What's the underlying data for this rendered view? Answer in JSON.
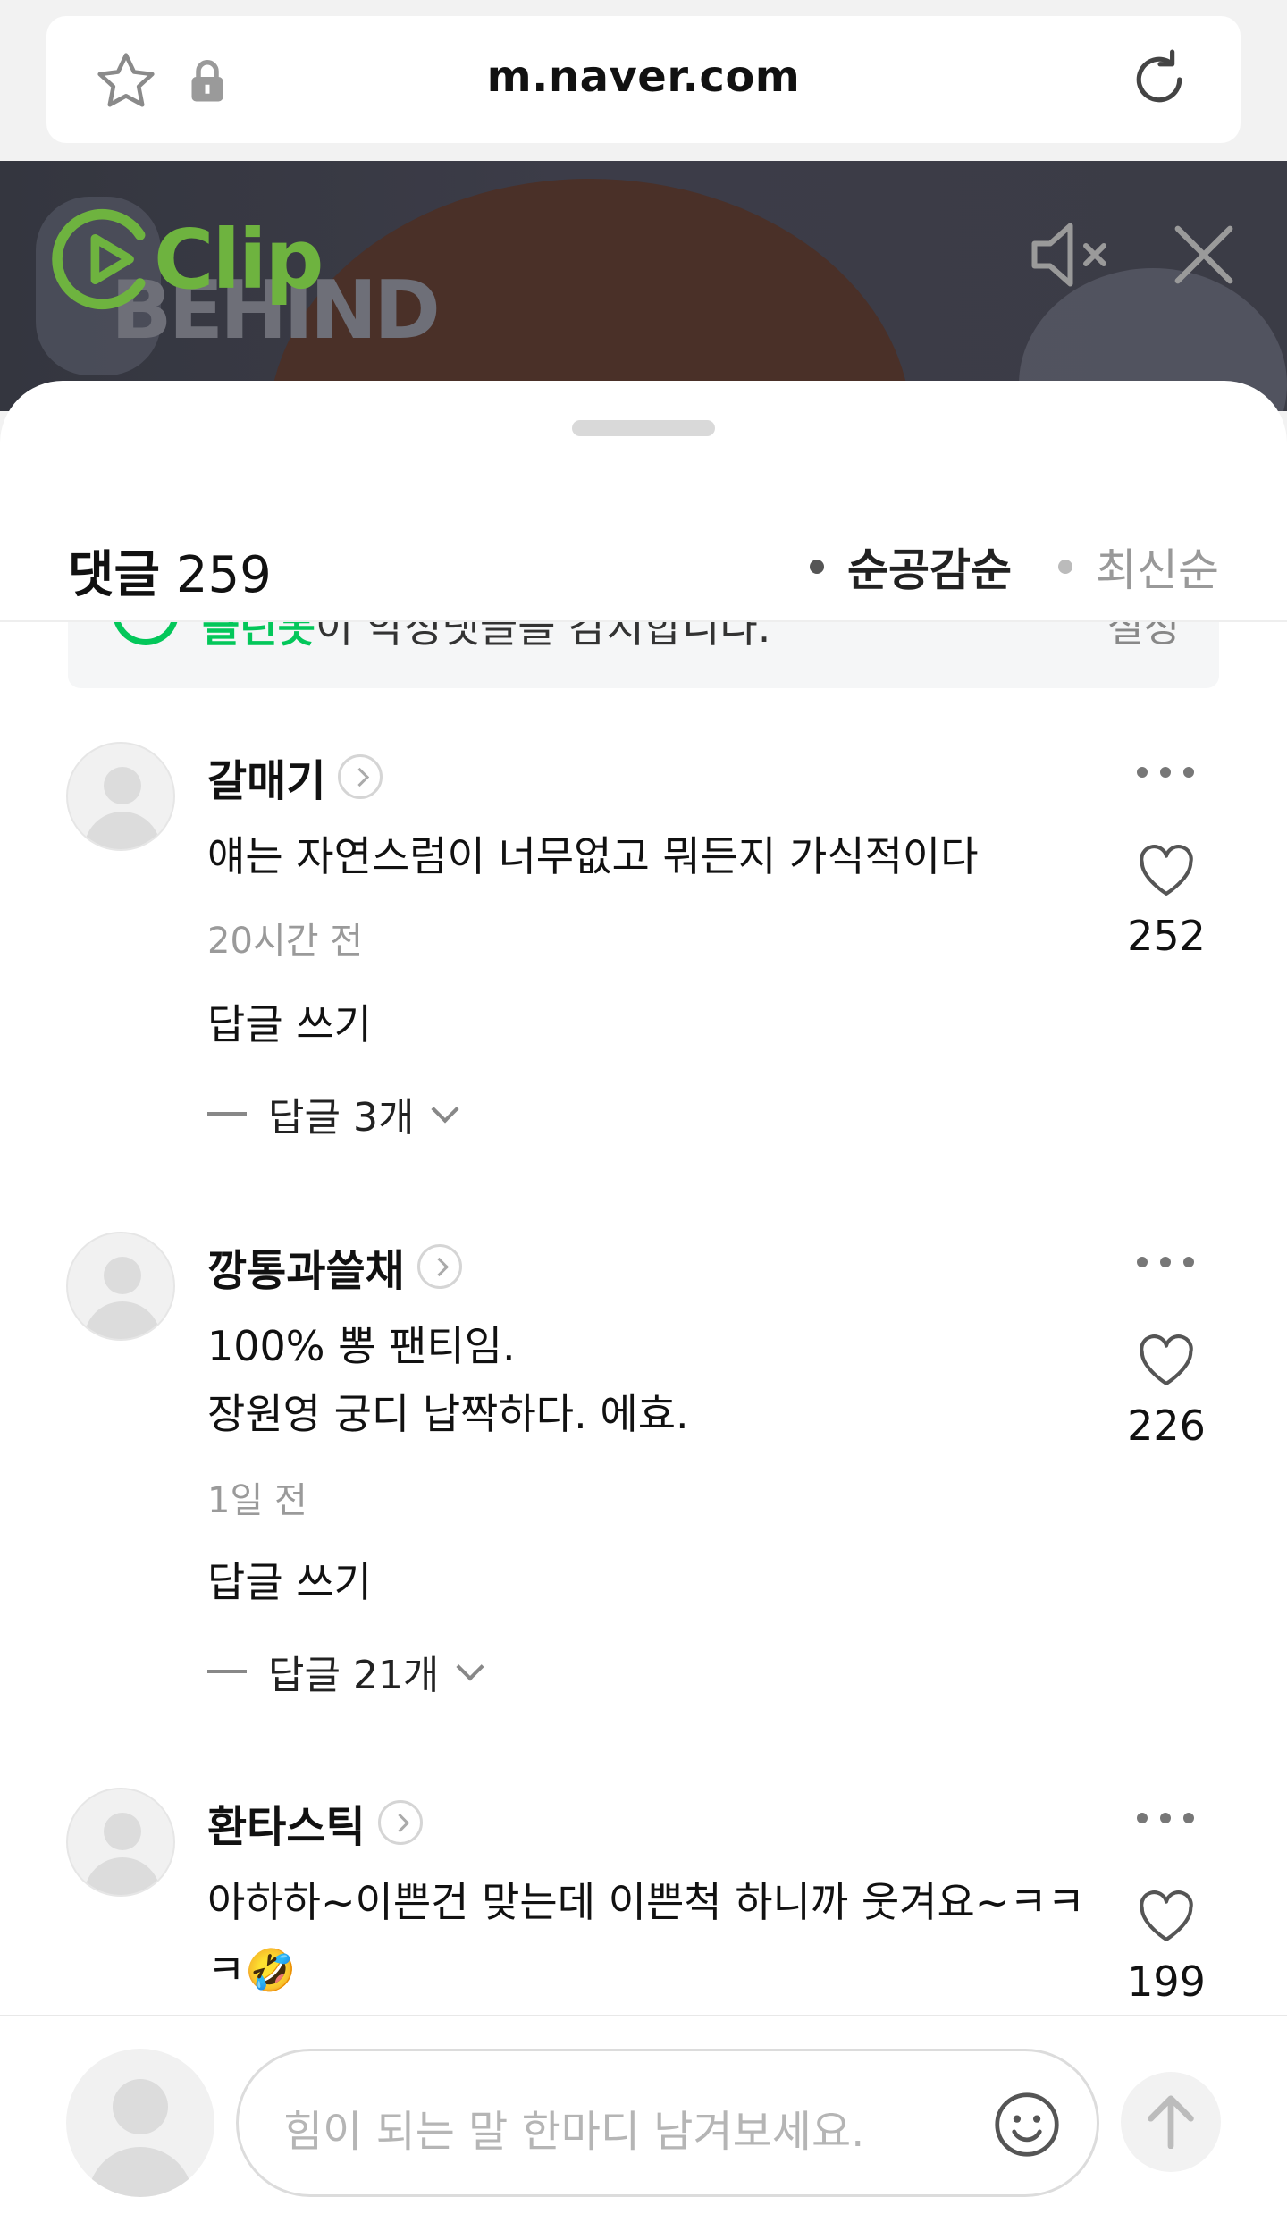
{
  "browser": {
    "url": "m.naver.com",
    "icons": [
      "star-icon",
      "lock-icon",
      "reload-icon"
    ]
  },
  "video": {
    "logo_text": "Clip",
    "overlay_text": "BEHIND",
    "icons": [
      "mute-icon",
      "close-icon"
    ]
  },
  "comments_panel": {
    "title_label": "댓글",
    "count": "259",
    "sort_options": [
      {
        "label": "순공감순",
        "active": true
      },
      {
        "label": "최신순",
        "active": false
      }
    ],
    "notice": {
      "highlight": "클린봇",
      "text": "이 악성댓글을 감지합니다.",
      "setting_label": "설정"
    }
  },
  "comments": [
    {
      "nickname": "갈매기",
      "body": "얘는 자연스럼이 너무없고 뭐든지 가식적이다",
      "time": "20시간 전",
      "reply_write": "답글 쓰기",
      "replies_label": "답글 3개",
      "likes": "252"
    },
    {
      "nickname": "깡통과쓸채",
      "body": "100% 뽕 팬티임.\n장원영 궁디 납짝하다. 에효.",
      "time": "1일 전",
      "reply_write": "답글 쓰기",
      "replies_label": "답글 21개",
      "likes": "226"
    },
    {
      "nickname": "환타스틱",
      "body": "아하하~이쁜건 맞는데 이쁜척 하니까 웃겨요~ㅋㅋㅋ🤣",
      "time": "",
      "reply_write": "",
      "replies_label": "",
      "likes": "199"
    }
  ],
  "input": {
    "placeholder": "힘이 되는 말 한마디 남겨보세요.",
    "icons": [
      "emoji-icon",
      "send-arrow-icon"
    ]
  },
  "colors": {
    "naver_green": "#03c75a",
    "clip_green": "#6eb33f",
    "text_primary": "#111111",
    "text_muted": "#9a9a9a"
  }
}
